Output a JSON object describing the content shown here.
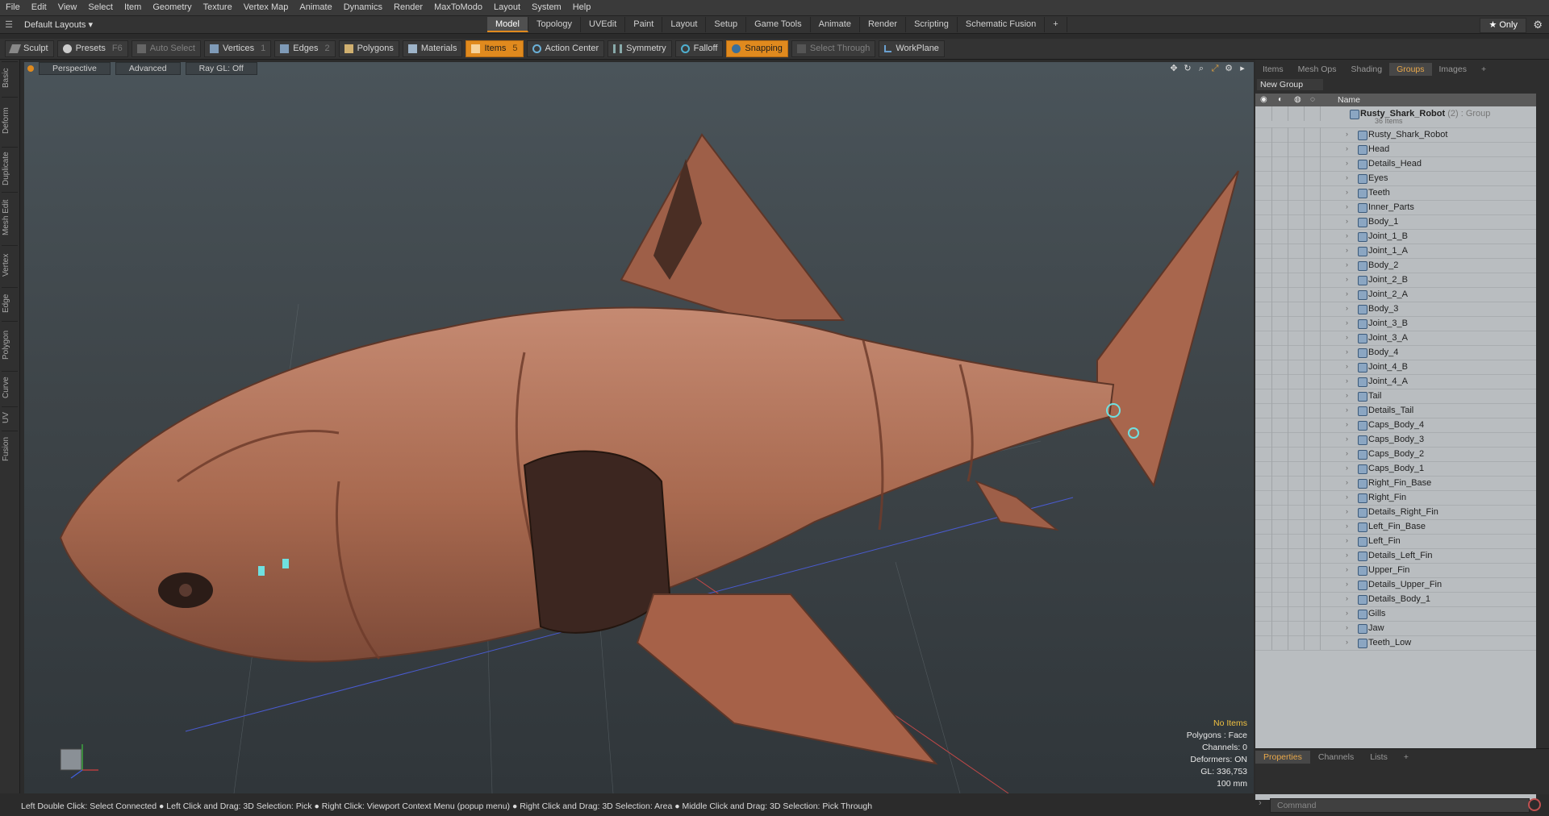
{
  "menu": [
    "File",
    "Edit",
    "View",
    "Select",
    "Item",
    "Geometry",
    "Texture",
    "Vertex Map",
    "Animate",
    "Dynamics",
    "Render",
    "MaxToModo",
    "Layout",
    "System",
    "Help"
  ],
  "layout_selector": "Default Layouts ▾",
  "tabs": [
    "Model",
    "Topology",
    "UVEdit",
    "Paint",
    "Layout",
    "Setup",
    "Game Tools",
    "Animate",
    "Render",
    "Scripting",
    "Schematic Fusion"
  ],
  "tab_plus": "+",
  "only_label": "★ Only",
  "toolbar": {
    "sculpt": "Sculpt",
    "presets": "Presets",
    "presets_key": "F6",
    "auto_select": "Auto Select",
    "vertices": "Vertices",
    "vertices_num": "1",
    "edges": "Edges",
    "edges_num": "2",
    "polygons": "Polygons",
    "materials": "Materials",
    "items": "Items",
    "items_num": "5",
    "action_center": "Action Center",
    "symmetry": "Symmetry",
    "falloff": "Falloff",
    "snapping": "Snapping",
    "select_through": "Select Through",
    "workplane": "WorkPlane"
  },
  "left_tabs": [
    "Basic",
    "Deform",
    "Duplicate",
    "Mesh Edit",
    "Vertex",
    "Edge",
    "Polygon",
    "Curve",
    "UV",
    "Fusion"
  ],
  "viewport": {
    "perspective": "Perspective",
    "advanced": "Advanced",
    "raygl": "Ray GL: Off",
    "info": [
      "No Items",
      "Polygons : Face",
      "Channels: 0",
      "Deformers: ON",
      "GL: 336,753",
      "100 mm"
    ]
  },
  "right_tabs": [
    "Items",
    "Mesh Ops",
    "Shading",
    "Groups",
    "Images",
    "+"
  ],
  "new_group": "New Group",
  "list_header": "Name",
  "root": {
    "name": "Rusty_Shark_Robot",
    "suffix": "(2) : Group",
    "count": "36 Items"
  },
  "items": [
    "Rusty_Shark_Robot",
    "Head",
    "Details_Head",
    "Eyes",
    "Teeth",
    "Inner_Parts",
    "Body_1",
    "Joint_1_B",
    "Joint_1_A",
    "Body_2",
    "Joint_2_B",
    "Joint_2_A",
    "Body_3",
    "Joint_3_B",
    "Joint_3_A",
    "Body_4",
    "Joint_4_B",
    "Joint_4_A",
    "Tail",
    "Details_Tail",
    "Caps_Body_4",
    "Caps_Body_3",
    "Caps_Body_2",
    "Caps_Body_1",
    "Right_Fin_Base",
    "Right_Fin",
    "Details_Right_Fin",
    "Left_Fin_Base",
    "Left_Fin",
    "Details_Left_Fin",
    "Upper_Fin",
    "Details_Upper_Fin",
    "Details_Body_1",
    "Gills",
    "Jaw",
    "Teeth_Low"
  ],
  "prop_tabs": [
    "Properties",
    "Channels",
    "Lists",
    "+"
  ],
  "command_placeholder": "Command",
  "status": "Left Double Click: Select Connected ● Left Click and Drag: 3D Selection: Pick ● Right Click: Viewport Context Menu (popup menu) ● Right Click and Drag: 3D Selection: Area ● Middle Click and Drag: 3D Selection: Pick Through",
  "colors": {
    "accent": "#e08a1e",
    "shark": "#b0705a"
  }
}
